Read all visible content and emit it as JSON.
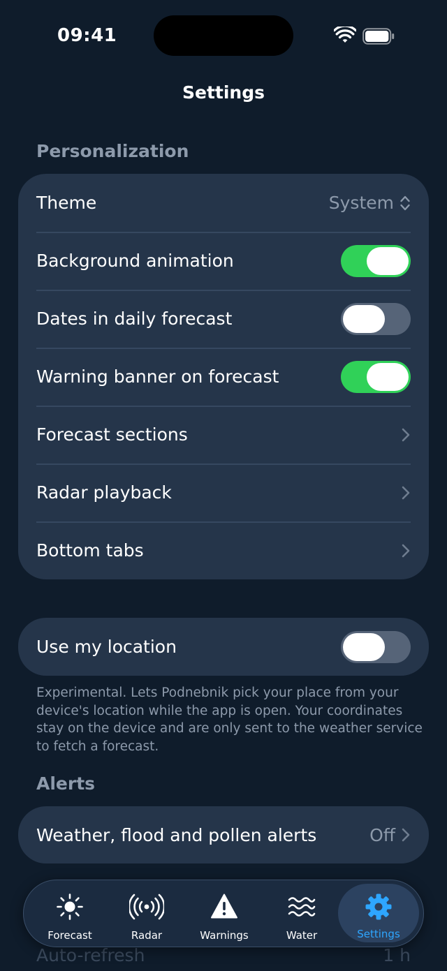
{
  "status": {
    "time": "09:41"
  },
  "header": {
    "title": "Settings"
  },
  "personalization": {
    "title": "Personalization",
    "theme": {
      "label": "Theme",
      "value": "System"
    },
    "background_animation": {
      "label": "Background animation",
      "enabled": true
    },
    "dates_in_daily_forecast": {
      "label": "Dates in daily forecast",
      "enabled": false
    },
    "warning_banner": {
      "label": "Warning banner on forecast",
      "enabled": true
    },
    "forecast_sections": {
      "label": "Forecast sections"
    },
    "radar_playback": {
      "label": "Radar playback"
    },
    "bottom_tabs": {
      "label": "Bottom tabs"
    }
  },
  "location": {
    "label": "Use my location",
    "enabled": false,
    "footnote": "Experimental. Lets Podnebnik pick your place from your device's location while the app is open. Your coordinates stay on the device and are only sent to the weather service to fetch a forecast."
  },
  "alerts": {
    "title": "Alerts",
    "weather_alerts": {
      "label": "Weather, flood and pollen alerts",
      "value": "Off"
    }
  },
  "refresh": {
    "label": "Auto-refresh",
    "value": "1 h"
  },
  "tabs": [
    {
      "label": "Forecast",
      "icon": "sun-icon",
      "active": false
    },
    {
      "label": "Radar",
      "icon": "radar-icon",
      "active": false
    },
    {
      "label": "Warnings",
      "icon": "warning-icon",
      "active": false
    },
    {
      "label": "Water",
      "icon": "water-icon",
      "active": false
    },
    {
      "label": "Settings",
      "icon": "gear-icon",
      "active": true
    }
  ],
  "colors": {
    "background": "#0f1c2b",
    "card": "#25354a",
    "toggle_on": "#30d158",
    "toggle_off": "#566478",
    "accent": "#2ea6ff",
    "secondary_text": "#8d9aab"
  }
}
